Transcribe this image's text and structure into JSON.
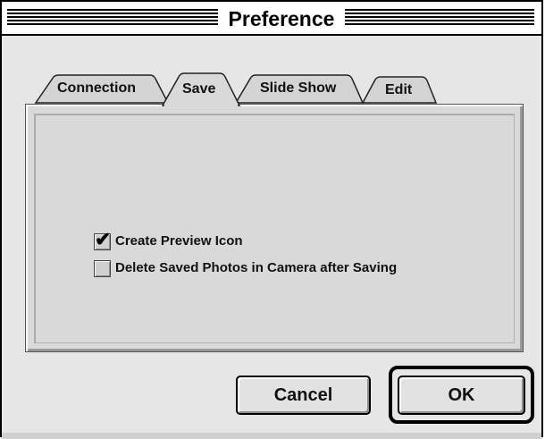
{
  "window": {
    "title": "Preference"
  },
  "tabs": [
    {
      "label": "Connection",
      "selected": false
    },
    {
      "label": "Save",
      "selected": true
    },
    {
      "label": "Slide Show",
      "selected": false
    },
    {
      "label": "Edit",
      "selected": false
    }
  ],
  "options": [
    {
      "label": "Create Preview Icon",
      "checked": true
    },
    {
      "label": "Delete Saved Photos in Camera after Saving",
      "checked": false
    }
  ],
  "buttons": {
    "cancel_label": "Cancel",
    "ok_label": "OK",
    "default": "OK"
  },
  "icons": {
    "checkmark": "check-icon"
  }
}
